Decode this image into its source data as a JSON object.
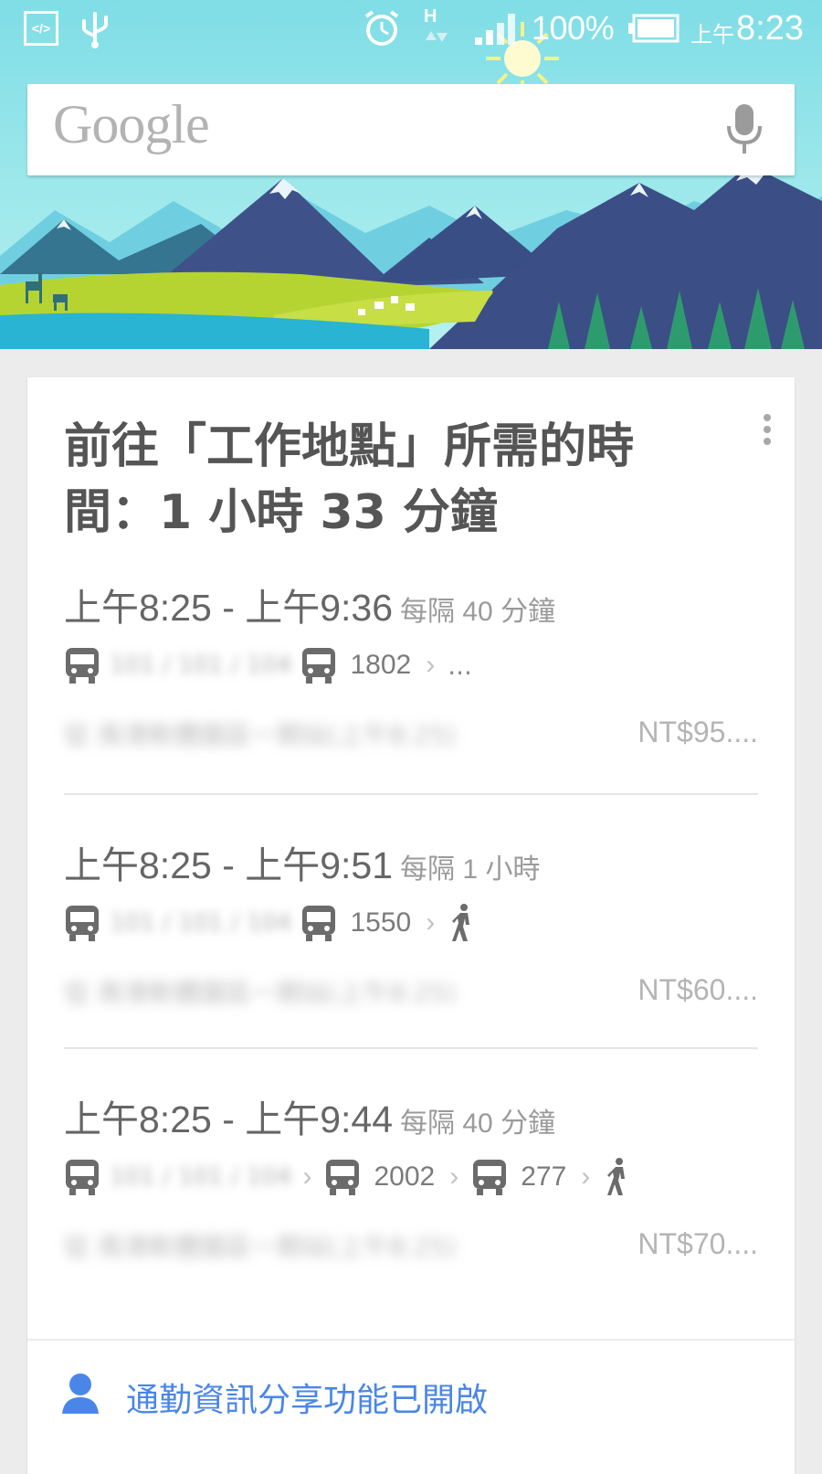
{
  "status_bar": {
    "battery_percent": "100%",
    "ampm": "上午",
    "time": "8:23",
    "data_indicator": "H",
    "dev_icon_label": "</>"
  },
  "search": {
    "logo": "Google"
  },
  "card": {
    "title": "前往「工作地點」所需的時間：1 小時 33 分鐘",
    "routes": [
      {
        "times": "上午8:25 - 上午9:36",
        "frequency": "每隔 40 分鐘",
        "legs": [
          {
            "type": "bus",
            "label": "101 / 101 / 104"
          },
          {
            "type": "bus",
            "label": "1802"
          },
          {
            "type": "more",
            "label": "..."
          }
        ],
        "detail_blurred": "從 南港軟體園區一期站(上午8:25)",
        "price": "NT$95...."
      },
      {
        "times": "上午8:25 - 上午9:51",
        "frequency": "每隔 1 小時",
        "legs": [
          {
            "type": "bus",
            "label": "101 / 101 / 104"
          },
          {
            "type": "bus",
            "label": "1550"
          },
          {
            "type": "walk",
            "label": ""
          }
        ],
        "detail_blurred": "從 南港軟體園區一期站(上午8:25)",
        "price": "NT$60...."
      },
      {
        "times": "上午8:25 - 上午9:44",
        "frequency": "每隔 40 分鐘",
        "legs": [
          {
            "type": "bus",
            "label": "101 / 101 / 104"
          },
          {
            "type": "bus",
            "label": "2002"
          },
          {
            "type": "bus",
            "label": "277"
          },
          {
            "type": "walk",
            "label": ""
          }
        ],
        "detail_blurred": "從 南港軟體園區一期站(上午8:25)",
        "price": "NT$70...."
      }
    ],
    "footer": {
      "label": "通勤資訊分享功能已開啟"
    }
  },
  "colors": {
    "accent": "#4a86e8",
    "sky": "#8ee3ea",
    "mountain": "#3e4f86",
    "meadow": "#b5d334"
  }
}
